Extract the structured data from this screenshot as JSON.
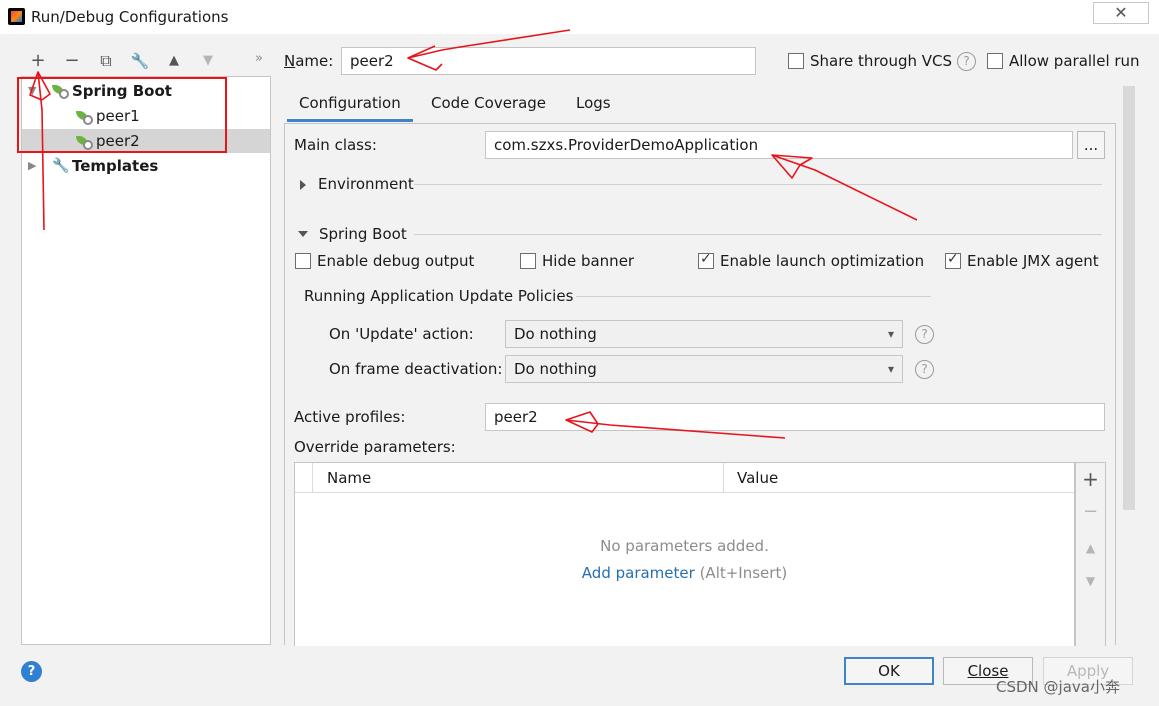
{
  "window": {
    "title": "Run/Debug Configurations",
    "close_glyph": "✕"
  },
  "toolbar": {
    "add": "+",
    "remove": "−",
    "copy": "⧉",
    "edit": "🔧",
    "up": "▲",
    "down": "▼",
    "more": "»"
  },
  "tree": {
    "group": "Spring Boot",
    "items": [
      {
        "label": "peer1"
      },
      {
        "label": "peer2"
      }
    ],
    "templates": "Templates"
  },
  "name_field": {
    "label": "Name:",
    "value": "peer2"
  },
  "options": {
    "share_vcs": "Share through VCS",
    "allow_parallel": "Allow parallel run",
    "help": "?"
  },
  "tabs": [
    "Configuration",
    "Code Coverage",
    "Logs"
  ],
  "config": {
    "main_class_label": "Main class:",
    "main_class_value": "com.szxs.ProviderDemoApplication",
    "browse": "...",
    "environment": "Environment",
    "spring_boot_section": "Spring Boot",
    "enable_debug_output": "Enable debug output",
    "hide_banner": "Hide banner",
    "enable_launch_optimization": "Enable launch optimization",
    "enable_jmx_agent": "Enable JMX agent",
    "update_policies_title": "Running Application Update Policies",
    "on_update_label": "On 'Update' action:",
    "on_update_value": "Do nothing",
    "on_frame_label": "On frame deactivation:",
    "on_frame_value": "Do nothing",
    "active_profiles_label": "Active profiles:",
    "active_profiles_value": "peer2",
    "override_label": "Override parameters:",
    "table": {
      "columns": [
        "Name",
        "Value"
      ],
      "empty": "No parameters added.",
      "add_link": "Add parameter",
      "add_shortcut": "(Alt+Insert)"
    },
    "side_tools": {
      "add": "+",
      "remove": "−",
      "up": "▲",
      "down": "▼"
    }
  },
  "buttons": {
    "help": "?",
    "ok": "OK",
    "close": "Close",
    "apply": "Apply"
  },
  "watermark": "CSDN @java小奔",
  "colors": {
    "annotation_red": "#e8141b",
    "accent_blue": "#4083c9",
    "spring_green": "#6db33f"
  }
}
